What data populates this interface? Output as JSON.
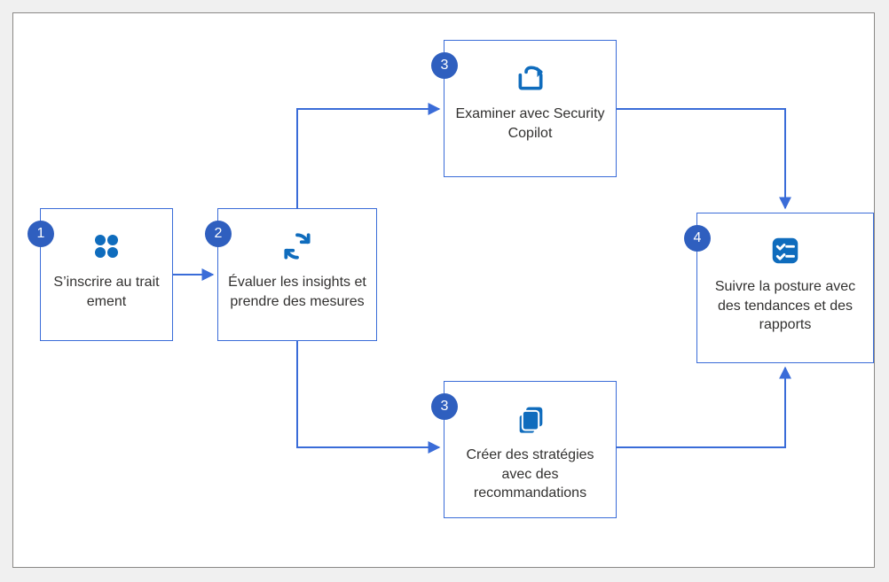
{
  "chart_data": {
    "type": "flowchart",
    "nodes": [
      {
        "id": "n1",
        "step": "1",
        "label": "S’inscrire au trait\nement",
        "icon": "grid-dots"
      },
      {
        "id": "n2",
        "step": "2",
        "label": "Évaluer les insights et prendre des mesures",
        "icon": "refresh"
      },
      {
        "id": "n3a",
        "step": "3",
        "label": "Examiner avec Security Copilot",
        "icon": "share"
      },
      {
        "id": "n3b",
        "step": "3",
        "label": "Créer des stratégies avec des recommandations",
        "icon": "stack"
      },
      {
        "id": "n4",
        "step": "4",
        "label": "Suivre la posture avec des tendances et des rapports",
        "icon": "checklist"
      }
    ],
    "edges": [
      {
        "from": "n1",
        "to": "n2"
      },
      {
        "from": "n2",
        "to": "n3a"
      },
      {
        "from": "n2",
        "to": "n3b"
      },
      {
        "from": "n3a",
        "to": "n4"
      },
      {
        "from": "n3b",
        "to": "n4"
      }
    ]
  },
  "nodes": {
    "n1": {
      "badge": "1",
      "label": "S’inscrire au trait ement"
    },
    "n2": {
      "badge": "2",
      "label": "Évaluer les insights et prendre des mesures"
    },
    "n3a": {
      "badge": "3",
      "label": "Examiner avec Security Copilot"
    },
    "n3b": {
      "badge": "3",
      "label": "Créer des stratégies avec des recommandations"
    },
    "n4": {
      "badge": "4",
      "label": "Suivre la posture avec des tendances et des rapports"
    }
  },
  "colors": {
    "accent": "#0f6cbd",
    "badge": "#2f5fbf",
    "border": "#3a6cd8",
    "connector": "#3a6cd8"
  }
}
